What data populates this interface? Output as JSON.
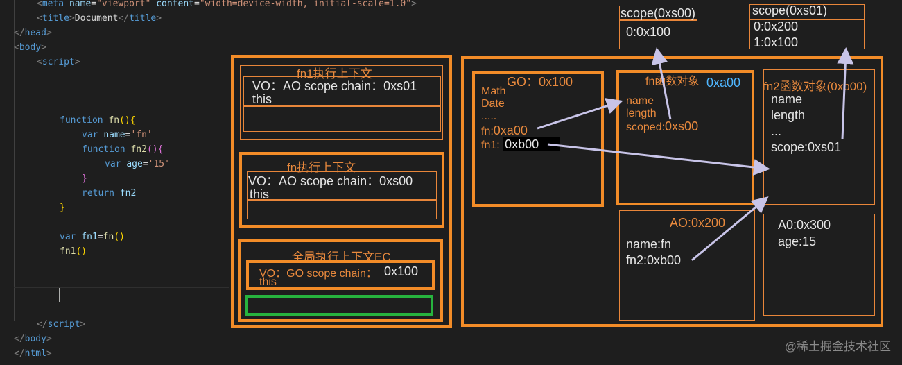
{
  "code": {
    "line_meta": {
      "open": "<",
      "tag": "meta",
      "a1": "name",
      "v1": "\"viewport\"",
      "a2": "content",
      "v2": "\"width=device-width, initial-scale=1.0\"",
      "close": ">"
    },
    "line_title": {
      "open": "<",
      "tag": "title",
      "mid": ">",
      "text": "Document",
      "open2": "</",
      "tag2": "title",
      "close": ">"
    },
    "line_head_close": {
      "open": "</",
      "tag": "head",
      "close": ">"
    },
    "line_body_open": {
      "open": "<",
      "tag": "body",
      "close": ">"
    },
    "line_script_open": {
      "open": "<",
      "tag": "script",
      "close": ">"
    },
    "line_fn": {
      "kw": "function",
      "name": "fn",
      "paren": "()",
      "brace": "{"
    },
    "line_var_name": {
      "kw": "var",
      "name": "name",
      "eq": "=",
      "val": "'fn'"
    },
    "line_fn2": {
      "kw": "function",
      "name": "fn2",
      "paren": "()",
      "brace": "{"
    },
    "line_var_age": {
      "kw": "var",
      "name": "age",
      "eq": "=",
      "val": "'15'"
    },
    "line_fn2_close": {
      "brace": "}"
    },
    "line_return": {
      "kw": "return",
      "name": "fn2"
    },
    "line_fn_close": {
      "brace": "}"
    },
    "line_var_fn1": {
      "kw": "var",
      "name": "fn1",
      "eq": "=",
      "call": "fn",
      "paren": "()"
    },
    "line_call": {
      "name": "fn1",
      "paren": "()"
    },
    "line_script_close": {
      "open": "</",
      "tag": "script",
      "close": ">"
    },
    "line_body_close": {
      "open": "</",
      "tag": "body",
      "close": ">"
    },
    "line_html_close": {
      "open": "</",
      "tag": "html",
      "close": ">"
    }
  },
  "stack": {
    "fn1_ec": {
      "title": "fn1执行上下文",
      "vo": "VO：AO  scope chain：0xs01",
      "this": "this"
    },
    "fn_ec": {
      "title": "fn执行上下文",
      "vo": "VO：AO  scope chain：0xs00",
      "this": "this"
    },
    "global_ec": {
      "title": "全局执行上下文EC",
      "vo": "VO：GO  scope chain：",
      "vo_value": "0x100",
      "this": "this"
    }
  },
  "heap": {
    "go": {
      "title": "GO：0x100",
      "lines": [
        "Math",
        "Date",
        "....."
      ],
      "fn_label": "fn:",
      "fn_value": "0xa00",
      "fn1_label": "fn1:",
      "fn1_value": "0xb00"
    },
    "fn_obj": {
      "title": "fn函数对象",
      "addr": "0xa00",
      "lines": [
        "name",
        "length"
      ],
      "scoped_label": "scoped:",
      "scoped_value": "0xs00"
    },
    "fn2_obj": {
      "title": "fn2函数对象(0xb00)",
      "lines": [
        "name",
        "length",
        "...",
        "scope:0xs01"
      ]
    },
    "ao_fn": {
      "title": "AO:0x200",
      "lines": [
        "name:fn",
        "fn2:0xb00"
      ]
    },
    "ao_fn2": {
      "title": "A0:0x300",
      "lines": [
        "age:15"
      ]
    }
  },
  "scopes": {
    "s00": {
      "title": "scope(0xs00)",
      "lines": [
        "0:0x100"
      ]
    },
    "s01": {
      "title": "scope(0xs01)",
      "lines": [
        "0:0x200",
        "1:0x100"
      ]
    }
  },
  "watermark": "@稀土掘金技术社区",
  "colors": {
    "orange": "#f28c28",
    "green": "#27b33e",
    "arrow": "#c8c4e8",
    "cyan": "#4fb6ff"
  }
}
